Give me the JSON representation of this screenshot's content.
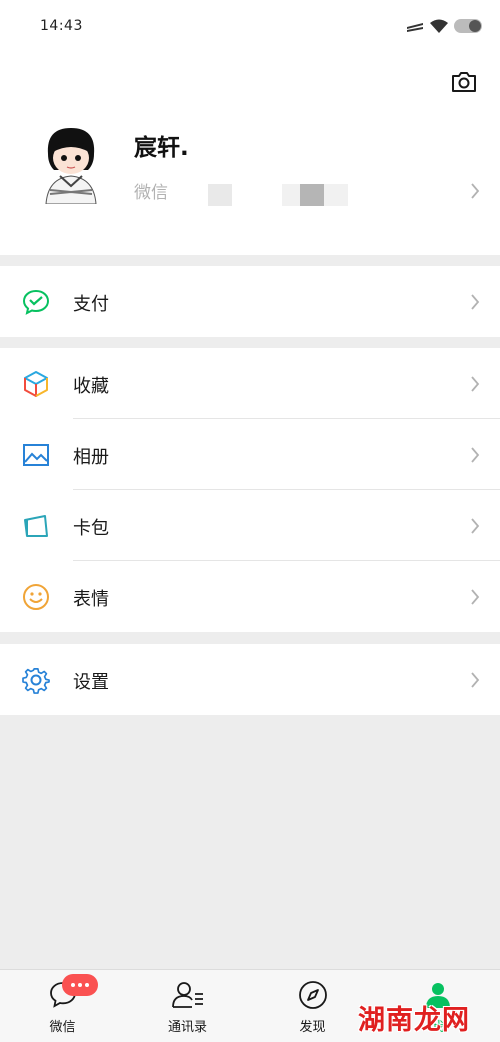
{
  "status_bar": {
    "time": "14:43"
  },
  "profile": {
    "name": "宸轩.",
    "wechat_id_label": "微信"
  },
  "menu": {
    "pay": {
      "label": "支付",
      "icon": "wechat-pay-icon",
      "color": "#07c160"
    },
    "favorites": {
      "label": "收藏",
      "icon": "cube-icon"
    },
    "album": {
      "label": "相册",
      "icon": "picture-icon",
      "color": "#2782d7"
    },
    "cards": {
      "label": "卡包",
      "icon": "card-wallet-icon",
      "color": "#2ba5b8"
    },
    "stickers": {
      "label": "表情",
      "icon": "smiley-icon",
      "color": "#f0a437"
    },
    "settings": {
      "label": "设置",
      "icon": "gear-icon",
      "color": "#2782d7"
    }
  },
  "tabbar": {
    "chats": {
      "label": "微信",
      "badge": "···"
    },
    "contacts": {
      "label": "通讯录"
    },
    "discover": {
      "label": "发现"
    },
    "me": {
      "label": "我",
      "active_color": "#07c160"
    }
  },
  "watermark": "湖南龙网"
}
